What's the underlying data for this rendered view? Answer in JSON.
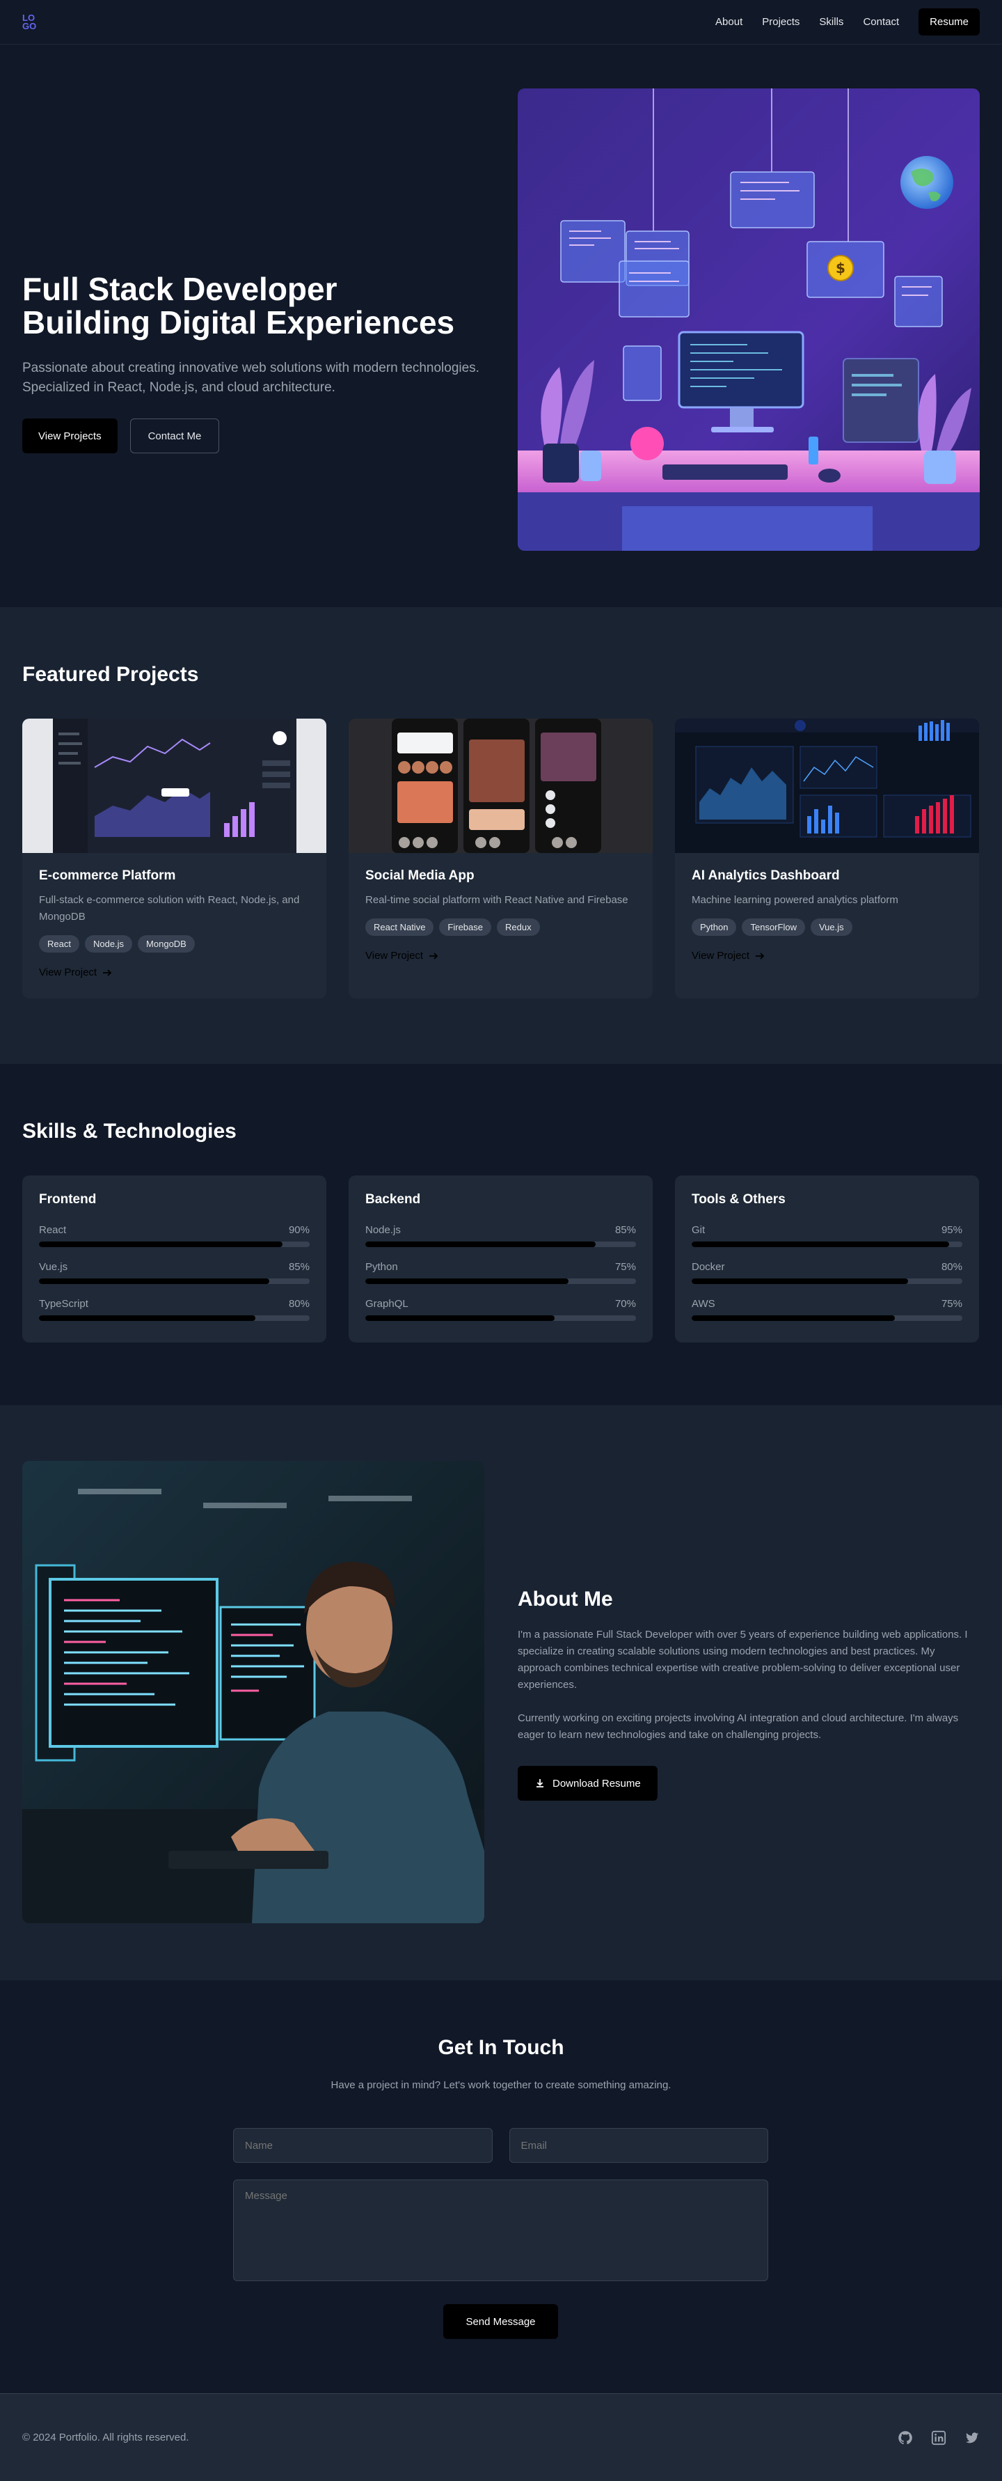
{
  "nav": {
    "logo_lines": [
      "LO",
      "GO"
    ],
    "links": [
      "About",
      "Projects",
      "Skills",
      "Contact"
    ],
    "resume_label": "Resume"
  },
  "hero": {
    "title_line1": "Full Stack Developer",
    "title_line2": "Building Digital Experiences",
    "subtitle": "Passionate about creating innovative web solutions with modern technologies. Specialized in React, Node.js, and cloud architecture.",
    "primary_label": "View Projects",
    "secondary_label": "Contact Me",
    "art_badge": "$"
  },
  "projects": {
    "title": "Featured Projects",
    "items": [
      {
        "title": "E-commerce Platform",
        "description": "Full-stack e-commerce solution with React, Node.js, and MongoDB",
        "tags": [
          "React",
          "Node.js",
          "MongoDB"
        ],
        "link": "View Project"
      },
      {
        "title": "Social Media App",
        "description": "Real-time social platform with React Native and Firebase",
        "tags": [
          "React Native",
          "Firebase",
          "Redux"
        ],
        "link": "View Project"
      },
      {
        "title": "AI Analytics Dashboard",
        "description": "Machine learning powered analytics platform",
        "tags": [
          "Python",
          "TensorFlow",
          "Vue.js"
        ],
        "link": "View Project"
      }
    ]
  },
  "skills": {
    "title": "Skills & Technologies",
    "groups": [
      {
        "name": "Frontend",
        "items": [
          {
            "name": "React",
            "label": "90%",
            "level": 0.9
          },
          {
            "name": "Vue.js",
            "label": "85%",
            "level": 0.85
          },
          {
            "name": "TypeScript",
            "label": "80%",
            "level": 0.8
          }
        ]
      },
      {
        "name": "Backend",
        "items": [
          {
            "name": "Node.js",
            "label": "85%",
            "level": 0.85
          },
          {
            "name": "Python",
            "label": "75%",
            "level": 0.75
          },
          {
            "name": "GraphQL",
            "label": "70%",
            "level": 0.7
          }
        ]
      },
      {
        "name": "Tools & Others",
        "items": [
          {
            "name": "Git",
            "label": "95%",
            "level": 0.95
          },
          {
            "name": "Docker",
            "label": "80%",
            "level": 0.8
          },
          {
            "name": "AWS",
            "label": "75%",
            "level": 0.75
          }
        ]
      }
    ]
  },
  "about": {
    "title": "About Me",
    "paragraph1": "I'm a passionate Full Stack Developer with over 5 years of experience building web applications. I specialize in creating scalable solutions using modern technologies and best practices. My approach combines technical expertise with creative problem-solving to deliver exceptional user experiences.",
    "paragraph2": "Currently working on exciting projects involving AI integration and cloud architecture. I'm always eager to learn new technologies and take on challenging projects.",
    "download_label": "Download Resume"
  },
  "contact": {
    "title": "Get In Touch",
    "subtitle": "Have a project in mind? Let's work together to create something amazing.",
    "name_placeholder": "Name",
    "email_placeholder": "Email",
    "message_placeholder": "Message",
    "send_label": "Send Message"
  },
  "footer": {
    "copyright": "© 2024 Portfolio. All rights reserved.",
    "socials": [
      "github-icon",
      "linkedin-icon",
      "twitter-icon"
    ]
  },
  "colors": {
    "background": "#111827",
    "surface": "#1f2937",
    "accent": "#6366f1",
    "button": "#000000"
  }
}
